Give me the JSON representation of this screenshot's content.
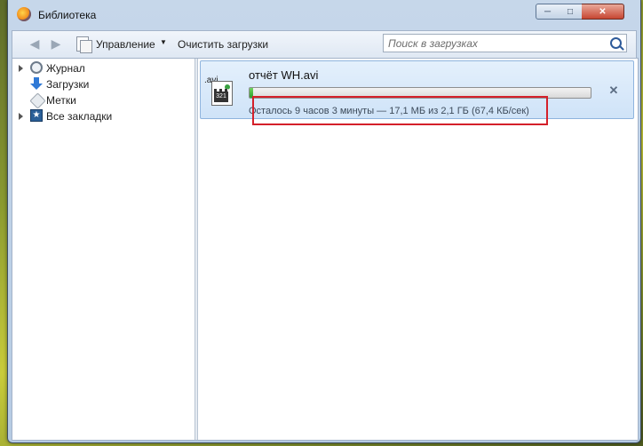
{
  "window": {
    "title": "Библиотека"
  },
  "toolbar": {
    "manage_label": "Управление",
    "clear_label": "Очистить загрузки",
    "search_placeholder": "Поиск в загрузках"
  },
  "sidebar": {
    "items": [
      {
        "label": "Журнал",
        "icon": "history-icon",
        "expandable": true
      },
      {
        "label": "Загрузки",
        "icon": "downloads-icon",
        "expandable": false,
        "selected": true
      },
      {
        "label": "Метки",
        "icon": "tags-icon",
        "expandable": false
      },
      {
        "label": "Все закладки",
        "icon": "bookmarks-icon",
        "expandable": true
      }
    ]
  },
  "download": {
    "file_name": "отчёт WH.avi",
    "file_ext": ".avi",
    "status": "Осталось 9 часов 3 минуты — 17,1 МБ из 2,1 ГБ (67,4 КБ/сек)",
    "progress": 0.008
  },
  "colors": {
    "highlight": "#d4202a",
    "accent": "#2f79d6",
    "progress": "#2c9e2a"
  }
}
